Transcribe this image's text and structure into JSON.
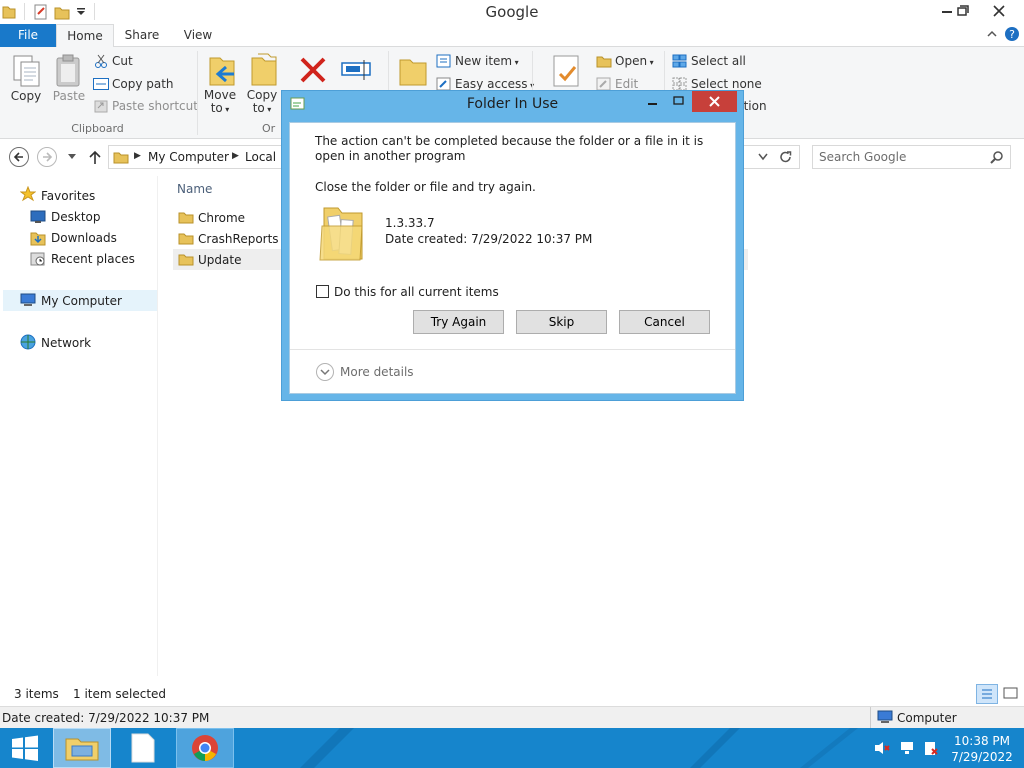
{
  "window": {
    "title": "Google"
  },
  "ribbon": {
    "tabs": {
      "file": "File",
      "home": "Home",
      "share": "Share",
      "view": "View"
    },
    "clipboard": {
      "copy": "Copy",
      "paste": "Paste",
      "cut": "Cut",
      "copy_path": "Copy path",
      "paste_shortcut": "Paste shortcut",
      "group_label": "Clipboard"
    },
    "organize": {
      "move_to_line1": "Move",
      "move_to_line2": "to",
      "copy_to_line1": "Copy",
      "copy_to_line2": "to",
      "group_label_partial": "Or"
    },
    "new": {
      "new_item": "New item",
      "easy_access": "Easy access"
    },
    "open": {
      "open": "Open",
      "edit": "Edit"
    },
    "select": {
      "select_all": "Select all",
      "select_none": "Select none",
      "invert_partial": "ction"
    }
  },
  "address": {
    "crumbs": [
      "My Computer",
      "Local D"
    ],
    "search_placeholder": "Search Google"
  },
  "nav_pane": {
    "favorites": "Favorites",
    "items": [
      "Desktop",
      "Downloads",
      "Recent places"
    ],
    "my_computer": "My Computer",
    "network": "Network"
  },
  "file_list": {
    "column_name": "Name",
    "rows": [
      "Chrome",
      "CrashReports",
      "Update"
    ],
    "selected": "Update"
  },
  "status": {
    "items_count": "3 items",
    "selected_count": "1 item selected",
    "details": "Date created: 7/29/2022 10:37 PM",
    "computer": "Computer"
  },
  "taskbar": {
    "time": "10:38 PM",
    "date": "7/29/2022"
  },
  "dialog": {
    "title": "Folder In Use",
    "message": "The action can't be completed because the folder or a file in it is open in another program",
    "instruction": "Close the folder or file and try again.",
    "item_name": "1.3.33.7",
    "item_date": "Date created: 7/29/2022 10:37 PM",
    "checkbox_label": "Do this for all current items",
    "buttons": {
      "try_again": "Try Again",
      "skip": "Skip",
      "cancel": "Cancel"
    },
    "more_details": "More details"
  },
  "colors": {
    "accent": "#1979ca",
    "taskbar": "#1685cc",
    "dialog_frame": "#66b5e8",
    "close_red": "#c7403a"
  }
}
